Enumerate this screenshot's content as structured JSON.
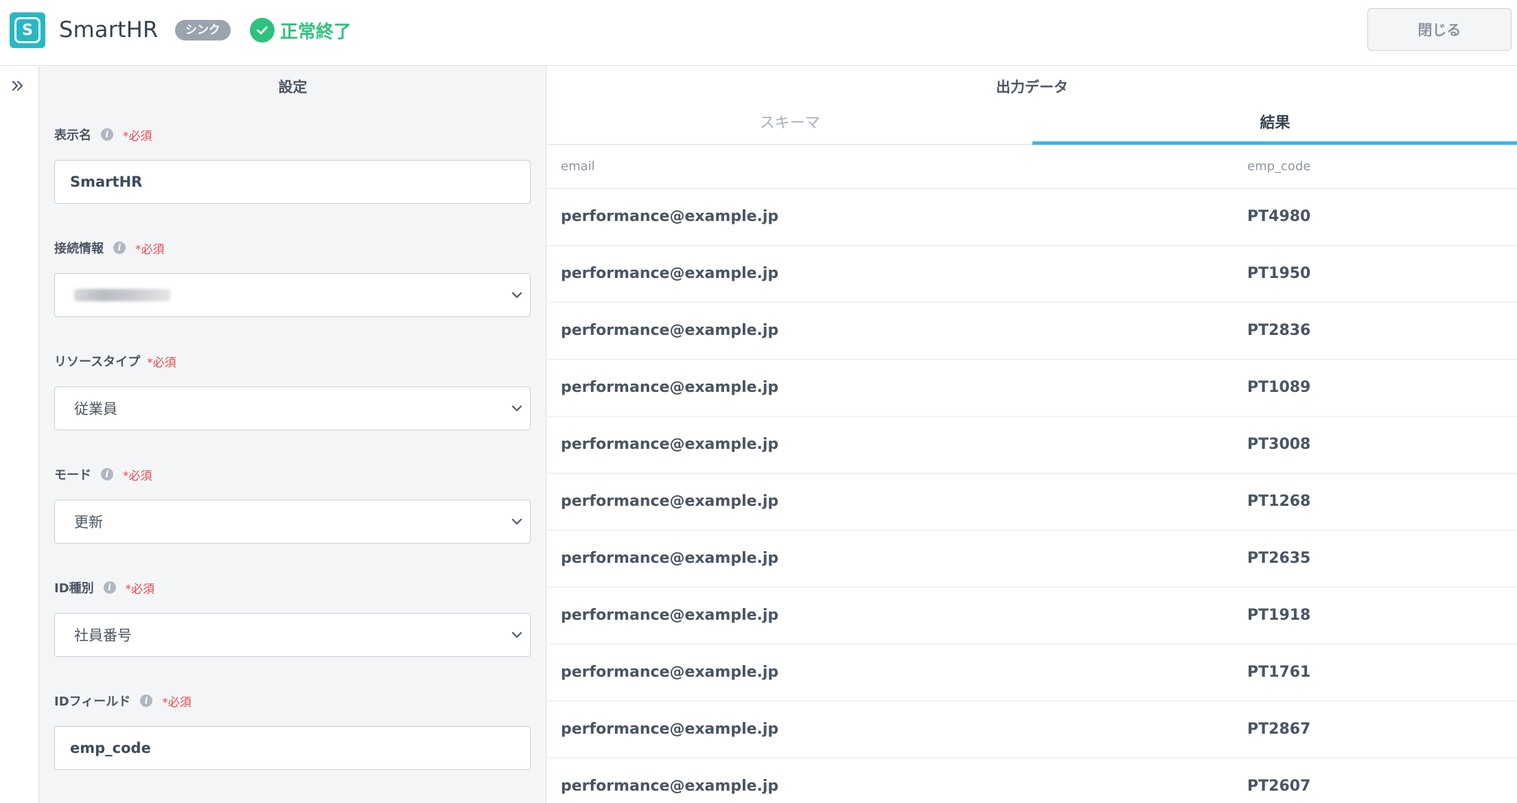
{
  "header": {
    "app_title": "SmartHR",
    "type_badge": "シンク",
    "status_text": "正常終了",
    "close_label": "閉じる",
    "logo_icon": "smarthr-logo-icon",
    "status_icon": "check-circle-icon"
  },
  "settings": {
    "title": "設定",
    "fields": {
      "display_name": {
        "label": "表示名",
        "required": "*必須",
        "value": "SmartHR"
      },
      "connection": {
        "label": "接続情報",
        "required": "*必須"
      },
      "resource_type": {
        "label": "リソースタイプ",
        "required": "*必須",
        "value": "従業員"
      },
      "mode": {
        "label": "モード",
        "required": "*必須",
        "value": "更新"
      },
      "id_type": {
        "label": "ID種別",
        "required": "*必須",
        "value": "社員番号"
      },
      "id_field": {
        "label": "IDフィールド",
        "required": "*必須",
        "value": "emp_code"
      }
    }
  },
  "output": {
    "title": "出力データ",
    "tabs": [
      {
        "label": "スキーマ",
        "active": false
      },
      {
        "label": "結果",
        "active": true
      }
    ],
    "columns": [
      "email",
      "emp_code"
    ],
    "rows": [
      [
        "performance@example.jp",
        "PT4980"
      ],
      [
        "performance@example.jp",
        "PT1950"
      ],
      [
        "performance@example.jp",
        "PT2836"
      ],
      [
        "performance@example.jp",
        "PT1089"
      ],
      [
        "performance@example.jp",
        "PT3008"
      ],
      [
        "performance@example.jp",
        "PT1268"
      ],
      [
        "performance@example.jp",
        "PT2635"
      ],
      [
        "performance@example.jp",
        "PT1918"
      ],
      [
        "performance@example.jp",
        "PT1761"
      ],
      [
        "performance@example.jp",
        "PT2867"
      ],
      [
        "performance@example.jp",
        "PT2607"
      ]
    ]
  },
  "colors": {
    "accent": "#3bb5e8",
    "success": "#2ec27e",
    "required": "#e5484d",
    "logo": "#27b8c4"
  }
}
